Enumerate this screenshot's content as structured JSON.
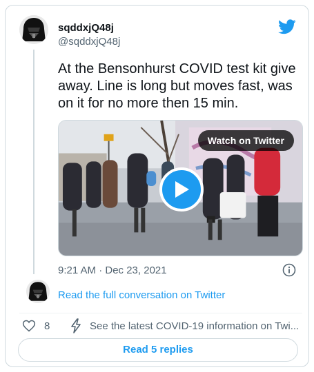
{
  "tweet": {
    "author": {
      "display_name": "sqddxjQ48j",
      "handle": "@sqddxjQ48j",
      "avatar_icon": "darth-vader-avatar-icon"
    },
    "brand_icon": "twitter-bird-icon",
    "brand_color": "#1d9bf0",
    "text": "At the Bensonhurst COVID test kit give away. Line is long but moves fast, was on it for no more then 15 min.",
    "media": {
      "type": "video",
      "watch_label": "Watch on Twitter",
      "play_icon": "play-icon"
    },
    "timestamp": "9:21 AM · Dec 23, 2021",
    "info_icon": "info-icon"
  },
  "conversation": {
    "link_label": "Read the full conversation on Twitter"
  },
  "actions": {
    "like_icon": "heart-icon",
    "like_count": "8",
    "covid_icon": "lightning-bolt-icon",
    "covid_info": "See the latest COVID-19 information on Twi..."
  },
  "replies": {
    "button_label": "Read 5 replies"
  }
}
